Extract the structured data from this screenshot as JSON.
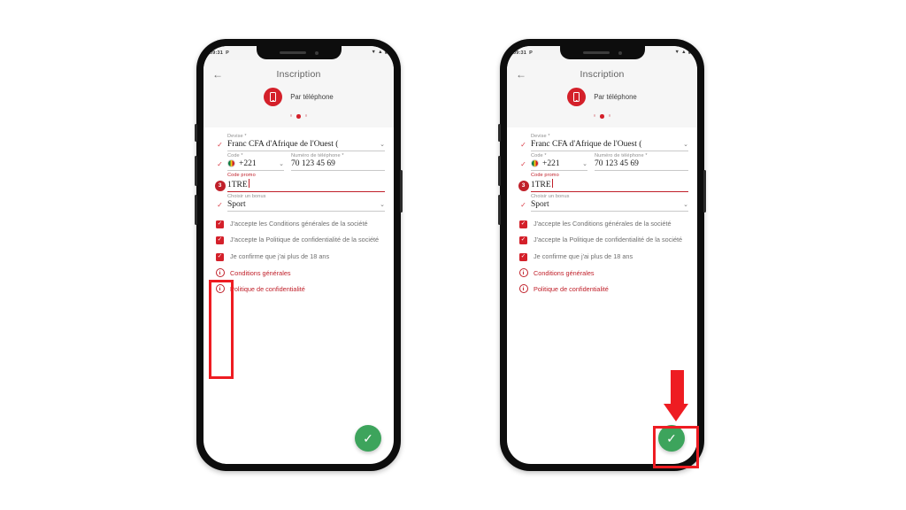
{
  "meta": {
    "background": "#ffffff",
    "brand_red": "#d4202a",
    "accent_red": "#c0202a",
    "highlight_red": "#ee1c22",
    "success_green": "#3da45c"
  },
  "status_bar": {
    "time": "09:31",
    "carrier_glyph": "P",
    "icons": [
      "wifi-icon",
      "signal-icon",
      "battery-icon"
    ],
    "wifi": "▼",
    "signal": "▲",
    "battery": "▮"
  },
  "app": {
    "back_icon": "←",
    "title": "Inscription",
    "method": {
      "icon": "phone-icon",
      "label": "Par téléphone"
    },
    "carousel": {
      "count": 3,
      "active_index": 1
    }
  },
  "form": {
    "fields": [
      {
        "name": "currency",
        "marker": "check",
        "marker_value": "✓",
        "label": "Devise *",
        "value": "Franc CFA d'Afrique de l'Ouest (",
        "chevron": "⌄"
      },
      {
        "name": "country-code",
        "marker": "check",
        "marker_value": "✓",
        "label": "Code *",
        "value": "+221",
        "flag": "senegal-flag",
        "chevron": "⌄"
      },
      {
        "name": "phone-number",
        "label": "Numéro de téléphone *",
        "value": "70 123 45 69"
      },
      {
        "name": "promo-code",
        "marker": "badge",
        "marker_value": "3",
        "label": "Code promo",
        "value": "1TRE"
      },
      {
        "name": "bonus",
        "marker": "check",
        "marker_value": "✓",
        "label": "Choisir un bonus",
        "value": "Sport",
        "chevron": "⌄"
      }
    ]
  },
  "consents": [
    {
      "name": "terms",
      "checked": true,
      "check_glyph": "✓",
      "text": "J'accepte les Conditions générales de la société"
    },
    {
      "name": "privacy",
      "checked": true,
      "check_glyph": "✓",
      "text": "J'accepte la Politique de confidentialité de la société"
    },
    {
      "name": "age",
      "checked": true,
      "check_glyph": "✓",
      "text": "Je confirme que j'ai plus de 18 ans"
    }
  ],
  "links": [
    {
      "name": "terms-link",
      "icon": "info-icon",
      "icon_glyph": "i",
      "text": "Conditions générales"
    },
    {
      "name": "privacy-link",
      "icon": "info-icon",
      "icon_glyph": "i",
      "text": "Politique de confidentialité"
    }
  ],
  "submit": {
    "icon": "check-icon",
    "glyph": "✓"
  },
  "annotations": {
    "checkbox_highlight": {
      "target": "consent-checkboxes",
      "color": "#ee1c22"
    },
    "fab_highlight": {
      "target": "submit-button",
      "color": "#ee1c22"
    },
    "arrow": {
      "direction": "down",
      "target": "submit-button",
      "color": "#ee1c22"
    }
  }
}
